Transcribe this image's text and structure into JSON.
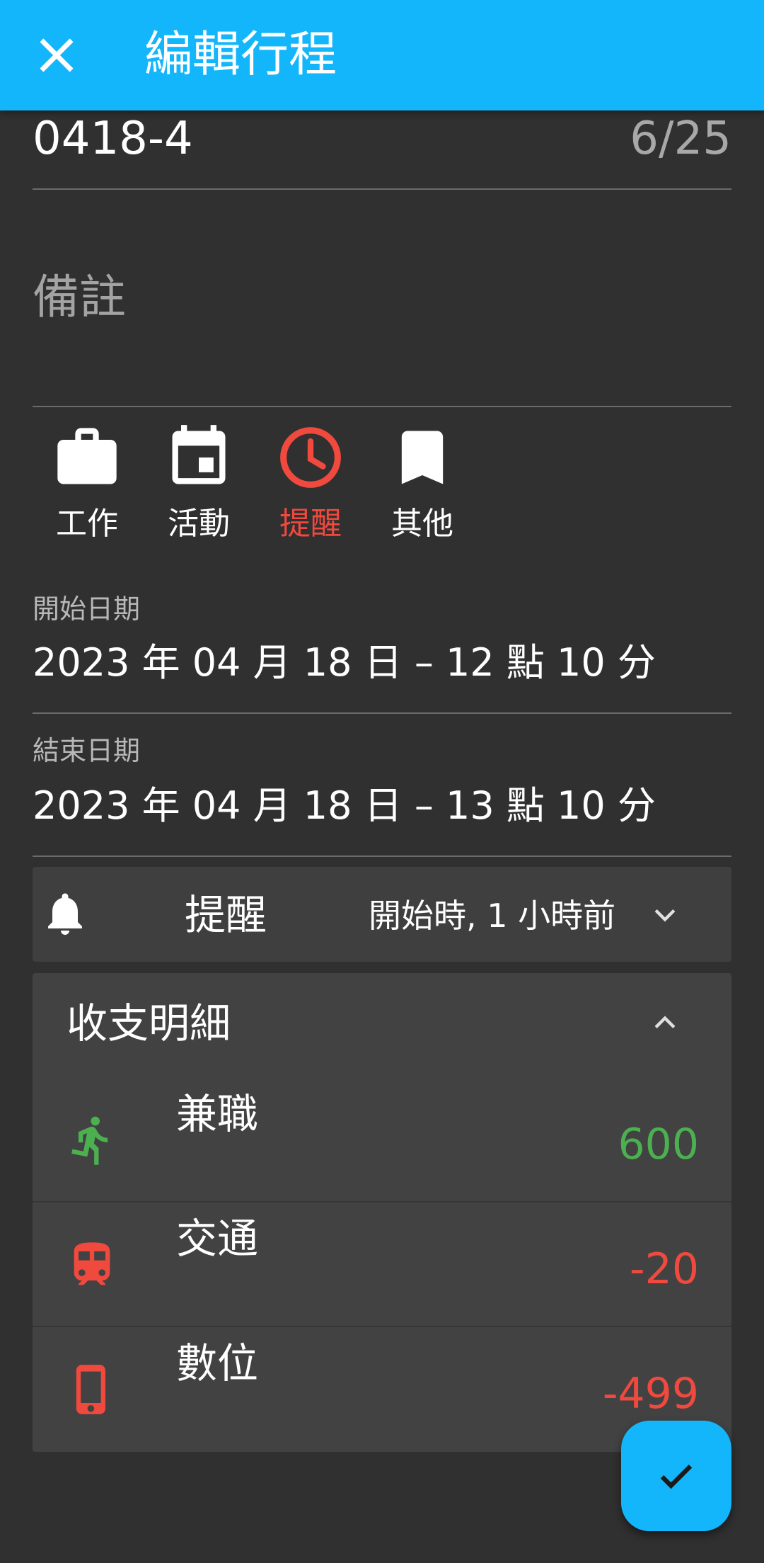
{
  "appbar": {
    "title": "編輯行程",
    "close_icon": "close-icon"
  },
  "title_field": {
    "value": "0418-4",
    "counter": "6/25"
  },
  "notes": {
    "placeholder": "備註"
  },
  "categories": [
    {
      "label": "工作",
      "icon": "briefcase-icon",
      "active": false
    },
    {
      "label": "活動",
      "icon": "calendar-icon",
      "active": false
    },
    {
      "label": "提醒",
      "icon": "clock-icon",
      "active": true
    },
    {
      "label": "其他",
      "icon": "bookmark-icon",
      "active": false
    }
  ],
  "start": {
    "label": "開始日期",
    "value": "2023 年 04 月 18 日 – 12 點 10 分"
  },
  "end": {
    "label": "結束日期",
    "value": "2023 年 04 月 18 日 – 13 點 10 分"
  },
  "reminder": {
    "label": "提醒",
    "value": "開始時, 1 小時前"
  },
  "ledger": {
    "title": "收支明細",
    "items": [
      {
        "name": "兼職",
        "amount": "600",
        "icon": "running-person-icon",
        "color": "#4caf50"
      },
      {
        "name": "交通",
        "amount": "-20",
        "icon": "train-icon",
        "color": "#f0493e"
      },
      {
        "name": "數位",
        "amount": "-499",
        "icon": "phone-icon",
        "color": "#f0493e"
      }
    ]
  },
  "colors": {
    "accent": "#14b6fb",
    "active": "#f0493e",
    "income": "#4caf50",
    "expense": "#f0493e"
  }
}
